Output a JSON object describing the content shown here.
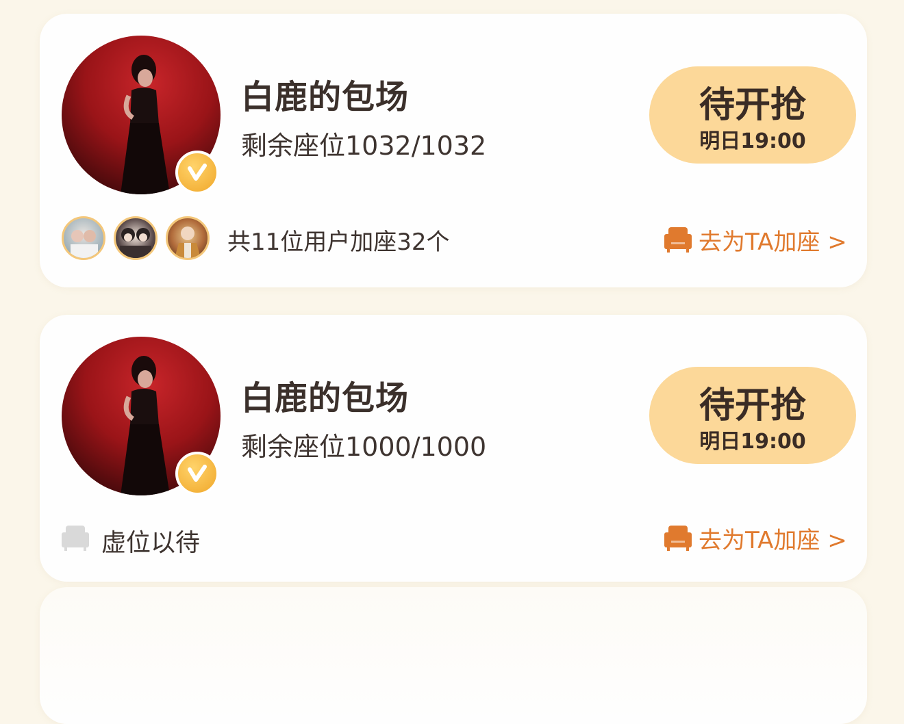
{
  "cards": [
    {
      "title": "白鹿的包场",
      "seats": "剩余座位1032/1032",
      "button_main": "待开抢",
      "button_sub": "明日19:00",
      "added_users": "共11位用户加座32个",
      "add_seat_link": "去为TA加座 >",
      "avatar_icon": "user-avatar",
      "verified_icon": "verified-badge-icon"
    },
    {
      "title": "白鹿的包场",
      "seats": "剩余座位1000/1000",
      "button_main": "待开抢",
      "button_sub": "明日19:00",
      "empty_seat_label": "虚位以待",
      "add_seat_link": "去为TA加座 >",
      "avatar_icon": "user-avatar",
      "verified_icon": "verified-badge-icon"
    }
  ],
  "colors": {
    "page_background": "#fbf6ea",
    "card_background": "#fefefe",
    "button_background": "#fcd899",
    "link_orange": "#e07a2e",
    "title_text": "#3b302b",
    "badge_gold": "#f0a72a"
  }
}
